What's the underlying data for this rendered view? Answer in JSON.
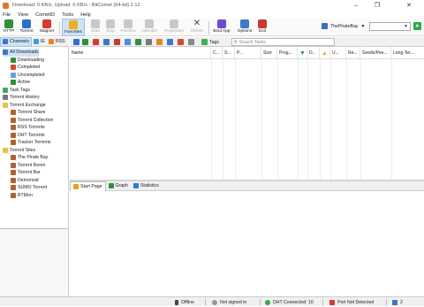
{
  "window": {
    "title": "Download: 0 KB/s, Upload: 0 KB/s - BitComet (64-bit) 2.12"
  },
  "menu": [
    "File",
    "View",
    "CometID",
    "Tools",
    "Help"
  ],
  "toolbar": {
    "items": [
      {
        "label": "HTTP",
        "icon": "http-add-icon",
        "color": "#2f8f3a"
      },
      {
        "label": "Torrent",
        "icon": "torrent-add-icon",
        "color": "#2e6fc8"
      },
      {
        "label": "Magnet",
        "icon": "magnet-icon",
        "color": "#d63b2f"
      },
      {
        "label": "Favorites",
        "icon": "favorites-icon",
        "color": "#e8b020"
      },
      {
        "label": "Start",
        "icon": "play-icon",
        "color": "#b8b8b8"
      },
      {
        "label": "Stop",
        "icon": "stop-icon",
        "color": "#b8b8b8"
      },
      {
        "label": "Preview",
        "icon": "preview-icon",
        "color": "#b8b8b8"
      },
      {
        "label": "OpenDir",
        "icon": "open-folder-icon",
        "color": "#b8b8b8"
      },
      {
        "label": "Properties",
        "icon": "properties-icon",
        "color": "#b8b8b8"
      },
      {
        "label": "Delete",
        "icon": "delete-icon",
        "color": "#444444"
      },
      {
        "label": "Bind App",
        "icon": "bind-app-icon",
        "color": "#6a4bd0"
      },
      {
        "label": "Options",
        "icon": "options-icon",
        "color": "#3f7ac4"
      },
      {
        "label": "Exit",
        "icon": "exit-icon",
        "color": "#c43b2f"
      }
    ],
    "search_site": "ThePirateBay"
  },
  "left_tabs": [
    {
      "label": "Channels",
      "icon": "channels-icon"
    },
    {
      "label": "IE",
      "icon": "ie-icon"
    },
    {
      "label": "RSS",
      "icon": "rss-icon"
    }
  ],
  "tree": [
    {
      "label": "All Downloads",
      "level": 0,
      "icon": "all-downloads-icon",
      "color": "#3a78c8"
    },
    {
      "label": "Downloading",
      "level": 1,
      "icon": "downloading-icon",
      "color": "#2f8f3a"
    },
    {
      "label": "Completed",
      "level": 1,
      "icon": "completed-icon",
      "color": "#d04c2a"
    },
    {
      "label": "Uncompleted",
      "level": 1,
      "icon": "uncompleted-icon",
      "color": "#6aa0d8"
    },
    {
      "label": "Active",
      "level": 1,
      "icon": "active-icon",
      "color": "#2f8f3a"
    },
    {
      "label": "Task Tags",
      "level": 0,
      "icon": "task-tags-icon",
      "color": "#3fae5a"
    },
    {
      "label": "Torrent History",
      "level": 0,
      "icon": "torrent-history-icon",
      "color": "#777777"
    },
    {
      "label": "Torrent Exchange",
      "level": 0,
      "icon": "folder-icon",
      "color": "#e8c040"
    },
    {
      "label": "Torrent Share",
      "level": 1,
      "icon": "torrent-share-icon",
      "color": "#b06030"
    },
    {
      "label": "Torrent Collection",
      "level": 1,
      "icon": "torrent-collection-icon",
      "color": "#b06030"
    },
    {
      "label": "RSS Torrents",
      "level": 1,
      "icon": "rss-torrents-icon",
      "color": "#b06030"
    },
    {
      "label": "DHT Torrents",
      "level": 1,
      "icon": "dht-torrents-icon",
      "color": "#b06030"
    },
    {
      "label": "Tracker Torrents",
      "level": 1,
      "icon": "tracker-torrents-icon",
      "color": "#b06030"
    },
    {
      "label": "Torrent Sites",
      "level": 0,
      "icon": "folder-icon",
      "color": "#e8c040"
    },
    {
      "label": "The Pirate Bay",
      "level": 1,
      "icon": "site-icon",
      "color": "#b06030"
    },
    {
      "label": "Torrent Room",
      "level": 1,
      "icon": "site-icon",
      "color": "#b06030"
    },
    {
      "label": "Torrent Bar",
      "level": 1,
      "icon": "site-icon",
      "color": "#b06030"
    },
    {
      "label": "Demonoid",
      "level": 1,
      "icon": "site-icon",
      "color": "#b06030"
    },
    {
      "label": "SUMO Torrent",
      "level": 1,
      "icon": "site-icon",
      "color": "#b06030"
    },
    {
      "label": "BTMon",
      "level": 1,
      "icon": "site-icon",
      "color": "#b06030"
    }
  ],
  "task_toolbar": {
    "tags_label": "Tags",
    "search_placeholder": "Search Tasks"
  },
  "columns": [
    "Name",
    "C...",
    "S...",
    "P...",
    "Size",
    "Prog...",
    "",
    "D...",
    "",
    "U...",
    "Re...",
    "Seeds/Pee...",
    "Long-Ter..."
  ],
  "bottom_tabs": [
    {
      "label": "Start Page",
      "icon": "start-page-icon"
    },
    {
      "label": "Graph",
      "icon": "graph-icon"
    },
    {
      "label": "Statistics",
      "icon": "statistics-icon"
    }
  ],
  "status": {
    "connection": "Offline",
    "account": "Not signed in",
    "dht": "DHT Connected: 10",
    "port": "Port Not Detected",
    "count": "2"
  }
}
